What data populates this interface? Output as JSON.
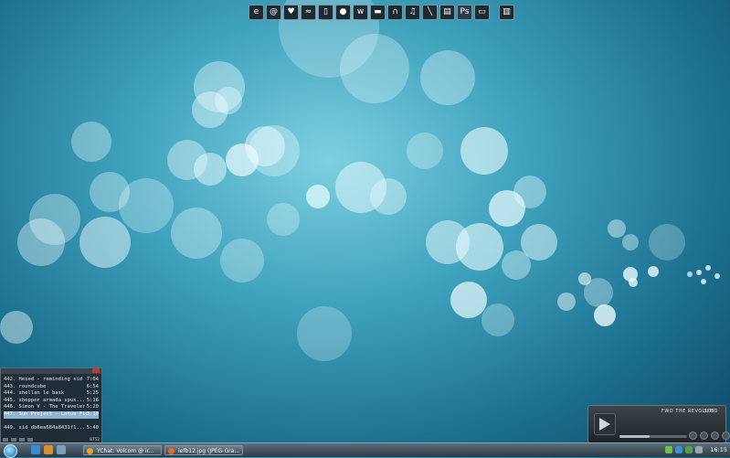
{
  "dock": {
    "icons": [
      "firefox-icon",
      "email-icon",
      "chat-icon",
      "wifi-icon",
      "document-icon",
      "messenger-icon",
      "winamp-icon",
      "media-icon",
      "headphones-icon",
      "music-icon",
      "paint-icon",
      "screen-icon",
      "photoshop-icon",
      "display-icon",
      "trash-icon"
    ],
    "photoshop_label": "Ps"
  },
  "playlist": {
    "rows": [
      {
        "title": "442. Hesed - reminding sid",
        "time": "7:04",
        "selected": false
      },
      {
        "title": "443. roundcube",
        "time": "6:54",
        "selected": false
      },
      {
        "title": "444. shellan le bask",
        "time": "5:25",
        "selected": false
      },
      {
        "title": "445. shepper armada  spus...",
        "time": "5:16",
        "selected": false
      },
      {
        "title": "446. Simon V - The Traveler",
        "time": "5:20",
        "selected": false
      },
      {
        "title": "447. Sun Project - Lotus Flo",
        "time": "3:10",
        "selected": true
      },
      {
        "title": "",
        "time": "",
        "selected": false
      },
      {
        "title": "449. sid db6ea684a8431f1...",
        "time": "5:40",
        "selected": false
      }
    ],
    "count": "8752"
  },
  "player": {
    "track_title": "FWD THE REVOLUTIO",
    "track_time": "3:08",
    "progress": 0.45
  },
  "taskbar": {
    "tasks": [
      {
        "label": "YChat: Volcom @ ir...",
        "color": "#f2a21f"
      },
      {
        "label": "iefb12.jpg (JPEG-Gra...",
        "color": "#e66b1c"
      }
    ],
    "clock": "16:15",
    "accent": "#1c6aa8"
  }
}
